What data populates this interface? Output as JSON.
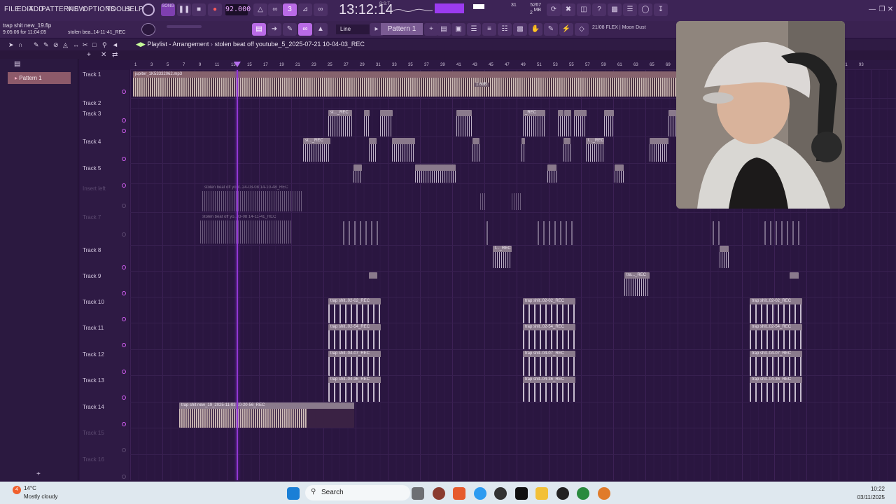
{
  "menu": [
    "FILE",
    "EDIT",
    "ADD",
    "PATTERNS",
    "VIEW",
    "OPTIONS",
    "TOOLS",
    "HELP"
  ],
  "transport": {
    "tempo": "92.000",
    "song_label": "SONG",
    "time": "13:12:14",
    "time_sub": "B:S:T",
    "mem_mb": "5267 MB",
    "mem_cpu": "31",
    "mem_poly": "2"
  },
  "project": {
    "name": "trap shit new_19.flp",
    "position": "9:05:06 for 11:04:05",
    "recording": "stolen bea..14-11-41_REC"
  },
  "toolbar2": {
    "snap": "Line",
    "pattern": "Pattern 1",
    "flex": "21/08  FLEX | Moon Dust"
  },
  "playlist": {
    "title": "Playlist - Arrangement",
    "subtitle": "stolen beat off youtube_5_2025-07-21 10-04-03_REC"
  },
  "picker": {
    "pattern_item": "Pattern 1"
  },
  "ruler": [
    "1",
    "3",
    "5",
    "7",
    "9",
    "11",
    "13",
    "15",
    "17",
    "19",
    "21",
    "23",
    "25",
    "27",
    "29",
    "31",
    "33",
    "35",
    "37",
    "39",
    "41",
    "43",
    "45",
    "47",
    "49",
    "51",
    "53",
    "55",
    "57",
    "59",
    "61",
    "63",
    "65",
    "69",
    "71",
    "73",
    "75",
    "77",
    "79",
    "81",
    "83",
    "85",
    "87",
    "89",
    "91",
    "93"
  ],
  "tracks": [
    {
      "label": "Track 1",
      "dim": false
    },
    {
      "label": "Track 2",
      "dim": false
    },
    {
      "label": "Track 3",
      "dim": false
    },
    {
      "label": "Track 4",
      "dim": false
    },
    {
      "label": "Track 5",
      "dim": false
    },
    {
      "label": "Insert left",
      "dim": true
    },
    {
      "label": "Track 7",
      "dim": true
    },
    {
      "label": "Track 8",
      "dim": false
    },
    {
      "label": "Track 9",
      "dim": false
    },
    {
      "label": "Track 10",
      "dim": false
    },
    {
      "label": "Track 11",
      "dim": false
    },
    {
      "label": "Track 12",
      "dim": false
    },
    {
      "label": "Track 13",
      "dim": false
    },
    {
      "label": "Track 14",
      "dim": false
    },
    {
      "label": "Track 15",
      "dim": true
    },
    {
      "label": "Track 16",
      "dim": true
    }
  ],
  "clips": {
    "jupiter": "jupiter_1K53332062.mp3",
    "jupiter_gain": "1.6dB",
    "st_rec": "st..._REC",
    "st_rec2": "st..._REC",
    "rec": "_REC",
    "t_rec": "t..._REC",
    "tra_rec": "tra..._REC",
    "stolen_a": "stolen beat off yout..24-03-08 14-10-48_REC",
    "stolen_b": "stolen beat off yo..03-08 14-11-41_REC",
    "trap_0202": "trap shit..02-02_REC",
    "trap_0254": "trap shit..02-54_REC",
    "trap_0407": "trap shit..04-07_REC",
    "trap_0436": "trap shit..04-36_REC",
    "trap_new": "trap shit new_19_2025-11-03 10-20-56_REC"
  },
  "taskbar": {
    "temp": "14°C",
    "weather": "Mostly cloudy",
    "search": "Search",
    "time": "10:22",
    "date": "03/11/2025"
  },
  "colors": {
    "accent": "#9b3bf0",
    "playhead": "#9138d4",
    "clip_title": "#8a7a8c",
    "pattern": "#8d5a6a"
  },
  "icons": [
    "record-icon",
    "play-icon",
    "stop-icon",
    "pattern-icon",
    "search-icon",
    "windows-start-icon",
    "webcam-feed"
  ]
}
